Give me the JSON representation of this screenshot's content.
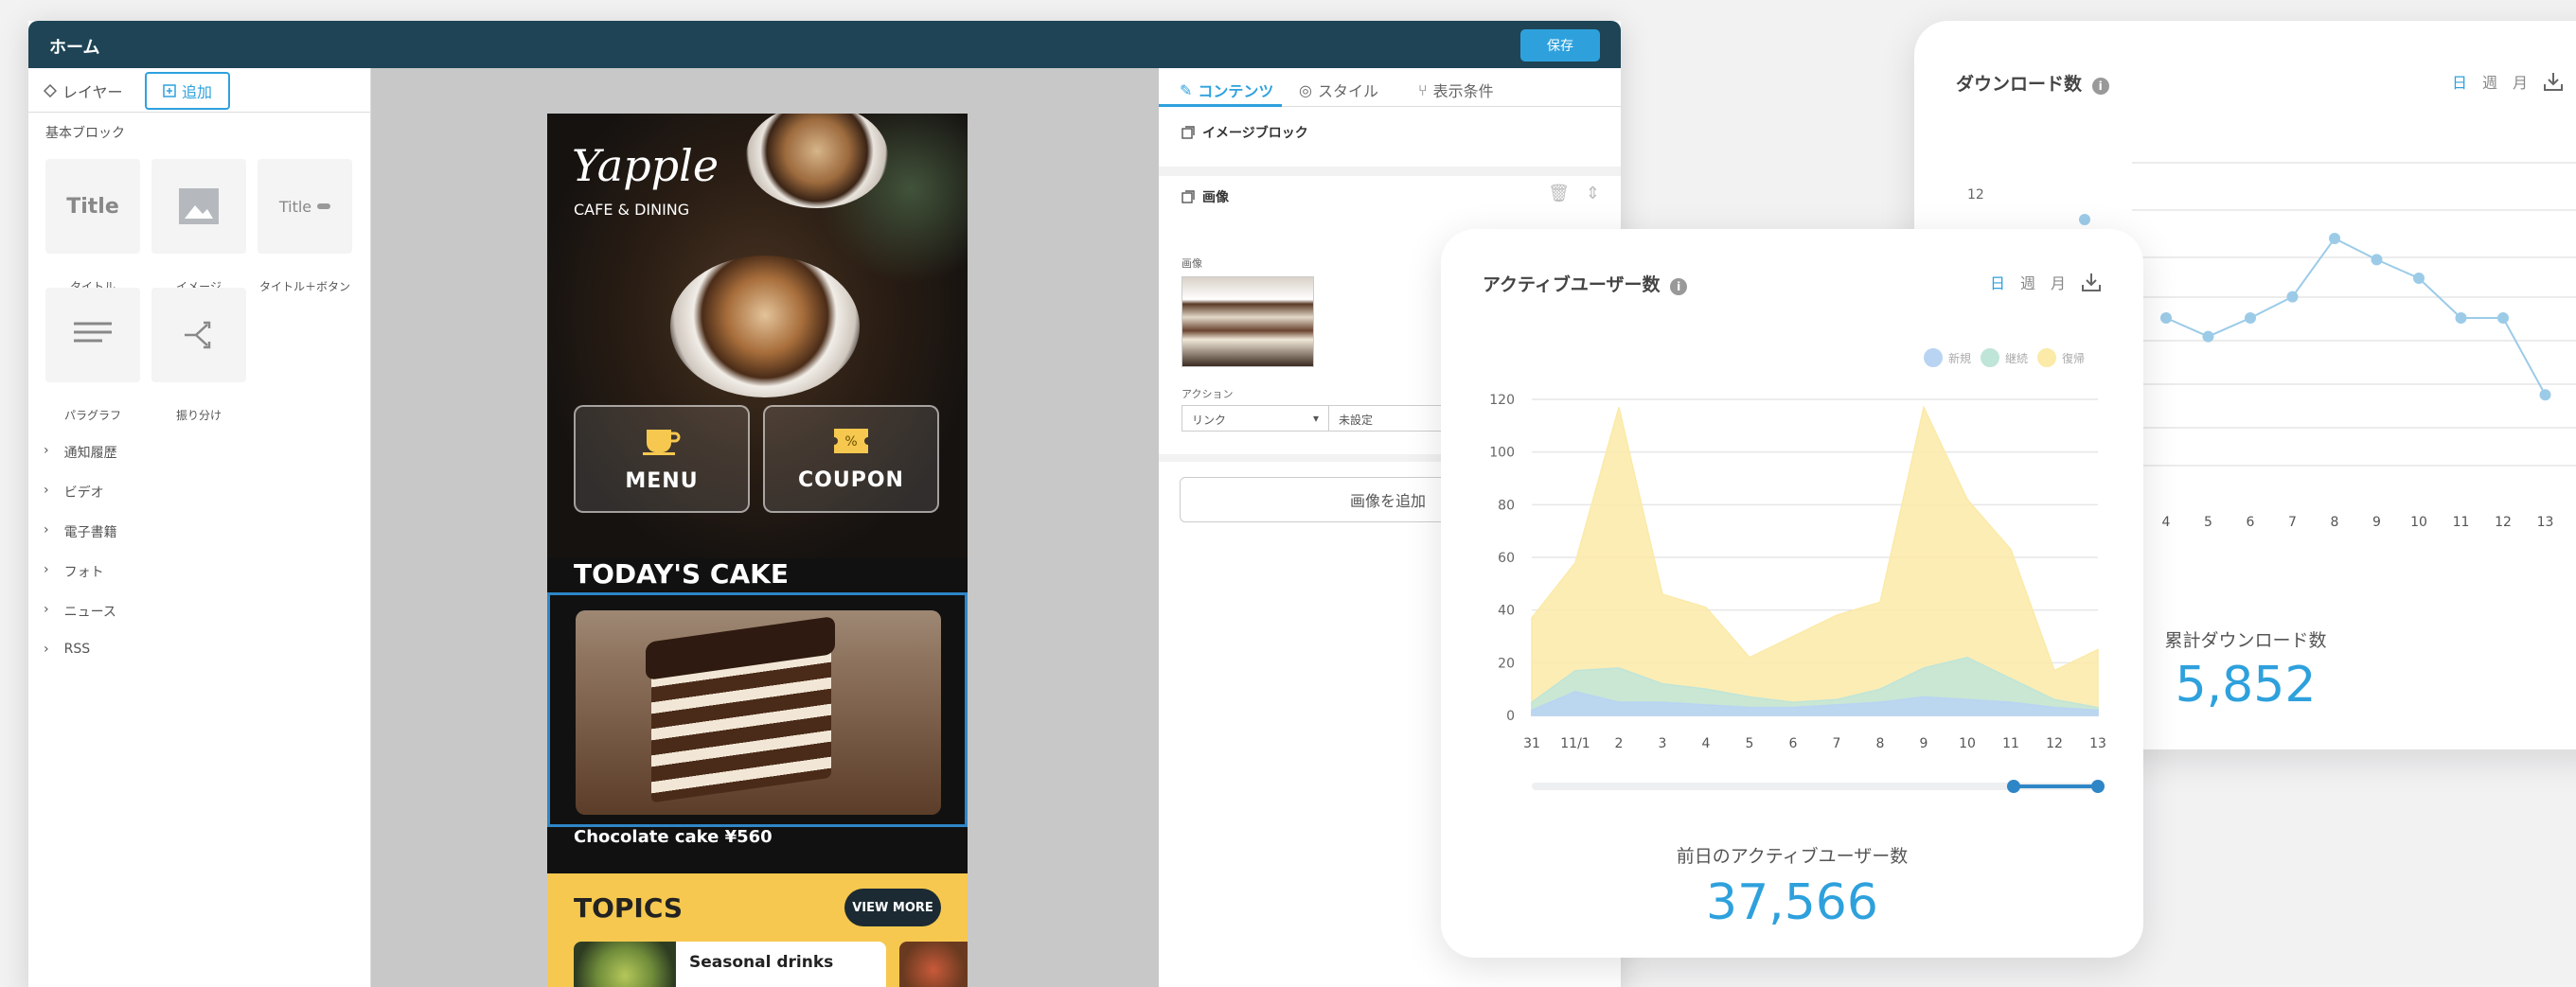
{
  "editor": {
    "header_title": "ホーム",
    "save_label": "保存",
    "left_tabs": {
      "layer": "レイヤー",
      "add": "追加"
    },
    "basic_blocks_title": "基本ブロック",
    "blocks": [
      {
        "thumb": "Title",
        "label": "タイトル",
        "icon": "title-icon"
      },
      {
        "thumb": "",
        "label": "イメージ",
        "icon": "image-icon"
      },
      {
        "thumb": "Title",
        "label": "タイトル＋ボタン",
        "icon": "title-button-icon"
      },
      {
        "thumb": "",
        "label": "パラグラフ",
        "icon": "paragraph-icon"
      },
      {
        "thumb": "",
        "label": "振り分け",
        "icon": "branch-icon"
      }
    ],
    "categories": [
      "通知履歴",
      "ビデオ",
      "電子書籍",
      "フォト",
      "ニュース",
      "RSS"
    ],
    "right_tabs": {
      "content": "コンテンツ",
      "style": "スタイル",
      "conditions": "表示条件"
    },
    "image_block_title": "イメージブロック",
    "image_section_title": "画像",
    "image_field_label": "画像",
    "action_label": "アクション",
    "action_select": "リンク",
    "action_value": "未設定",
    "add_image_button": "画像を追加"
  },
  "phone": {
    "logo": "Yapple",
    "logo_sub": "CAFE & DINING",
    "menu_label": "MENU",
    "coupon_label": "COUPON",
    "today_title": "TODAY'S CAKE",
    "cake_caption": "Chocolate cake  ¥560",
    "topics_title": "TOPICS",
    "view_more": "VIEW MORE",
    "topic_item": "Seasonal drinks"
  },
  "active_users": {
    "title": "アクティブユーザー数",
    "periods": [
      "日",
      "週",
      "月"
    ],
    "active_period": "日",
    "legend": [
      "新規",
      "継続",
      "復帰"
    ],
    "summary_label": "前日のアクティブユーザー数",
    "summary_value": "37,566",
    "chart_data": {
      "type": "area",
      "categories": [
        "31",
        "11/1",
        "2",
        "3",
        "4",
        "5",
        "6",
        "7",
        "8",
        "9",
        "10",
        "11",
        "12",
        "13"
      ],
      "ylim": [
        0,
        120
      ],
      "yticks": [
        0,
        20,
        40,
        60,
        80,
        100,
        120
      ],
      "grid": true,
      "legend_position": "top-right",
      "series": [
        {
          "name": "新規",
          "color": "#b9d4f3",
          "values": [
            2,
            9,
            5,
            5,
            4,
            3,
            3,
            4,
            5,
            7,
            6,
            5,
            3,
            2
          ]
        },
        {
          "name": "継続",
          "color": "#bfe5d8",
          "values": [
            5,
            17,
            18,
            12,
            10,
            7,
            5,
            6,
            10,
            18,
            22,
            14,
            6,
            3
          ]
        },
        {
          "name": "復帰",
          "color": "#fbeaa8",
          "values": [
            37,
            58,
            117,
            46,
            41,
            22,
            30,
            38,
            43,
            117,
            82,
            63,
            17,
            25
          ]
        }
      ]
    }
  },
  "downloads": {
    "title": "ダウンロード数",
    "periods": [
      "日",
      "週",
      "月"
    ],
    "active_period": "日",
    "summary_label": "累計ダウンロード数",
    "summary_value": "5,852",
    "chart_data": {
      "type": "line",
      "categories": [
        "4",
        "5",
        "6",
        "7",
        "8",
        "9",
        "10",
        "11",
        "12",
        "13"
      ],
      "ytick_label": "12",
      "grid": true,
      "series": [
        {
          "name": "",
          "color": "#9ccbe8",
          "values": [
            7,
            6.3,
            7,
            7.8,
            10,
            9.2,
            8.5,
            7,
            7,
            4.1
          ]
        }
      ]
    }
  }
}
